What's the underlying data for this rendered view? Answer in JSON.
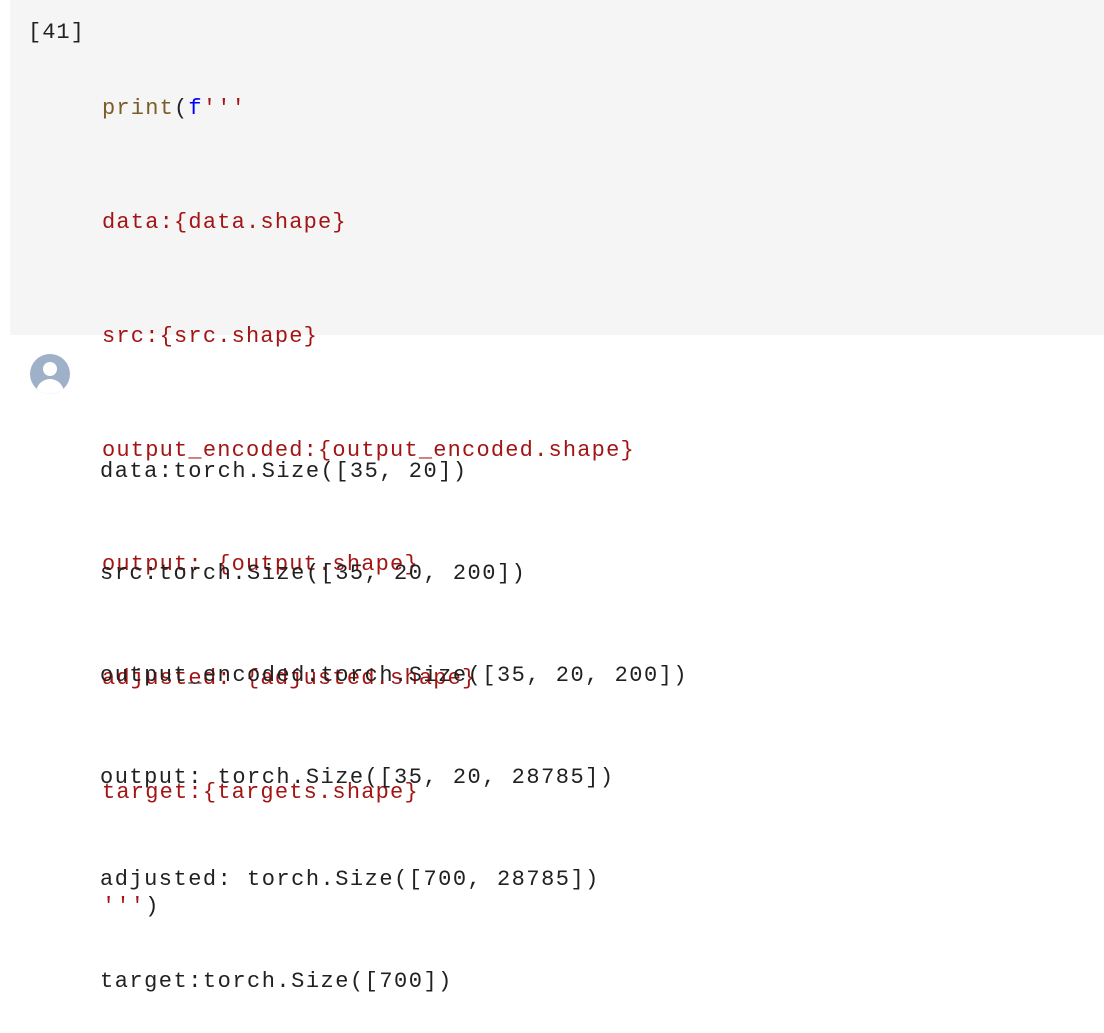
{
  "cell": {
    "execution_count": "[41]",
    "code": {
      "call_fn": "print",
      "open_paren": "(",
      "fstring_prefix": "f",
      "triple_quote_open": "'''",
      "lines": [
        "data:{data.shape}",
        "src:{src.shape}",
        "output_encoded:{output_encoded.shape}",
        "output: {output.shape}",
        "adjusted: {adjusted.shape}",
        "target:{targets.shape}"
      ],
      "triple_quote_close": "'''",
      "close_paren": ")"
    }
  },
  "output": {
    "avatar_icon": "user-avatar-icon",
    "lines": [
      "data:torch.Size([35, 20])",
      "src:torch.Size([35, 20, 200])",
      "output_encoded:torch.Size([35, 20, 200])",
      "output: torch.Size([35, 20, 28785])",
      "adjusted: torch.Size([700, 28785])",
      "target:torch.Size([700])"
    ]
  },
  "colors": {
    "cell_background": "#f5f5f5",
    "string": "#a31515",
    "function": "#795e26",
    "keyword": "#0000ff",
    "text": "#212121",
    "avatar": "#9fb0c9"
  }
}
